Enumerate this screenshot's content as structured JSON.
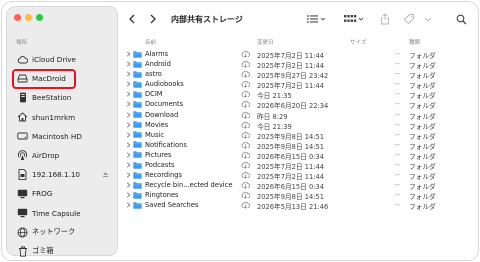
{
  "sidebar": {
    "section": "場所",
    "items": [
      {
        "label": "iCloud Drive",
        "icon": "cloud-icon",
        "selected": false,
        "eject": false
      },
      {
        "label": "MacDroid",
        "icon": "drive-icon",
        "selected": true,
        "eject": false
      },
      {
        "label": "BeeStation",
        "icon": "nas-icon",
        "selected": false,
        "eject": false
      },
      {
        "label": "shun1mrkm",
        "icon": "home-icon",
        "selected": false,
        "eject": false
      },
      {
        "label": "Macintosh HD",
        "icon": "hard-drive-icon",
        "selected": false,
        "eject": false
      },
      {
        "label": "AirDrop",
        "icon": "airdrop-icon",
        "selected": false,
        "eject": false
      },
      {
        "label": "192.168.1.10",
        "icon": "document-icon",
        "selected": false,
        "eject": true
      },
      {
        "label": "FROG",
        "icon": "monitor-icon",
        "selected": false,
        "eject": false
      },
      {
        "label": "Time Capsule",
        "icon": "monitor-icon",
        "selected": false,
        "eject": false
      },
      {
        "label": "ネットワーク",
        "icon": "network-icon",
        "selected": false,
        "eject": false
      },
      {
        "label": "ゴミ箱",
        "icon": "trash-icon",
        "selected": false,
        "eject": false
      }
    ]
  },
  "toolbar": {
    "title": "内部共有ストレージ"
  },
  "columns": {
    "name": "名前",
    "date": "変更日",
    "size": "サイズ",
    "kind": "種類"
  },
  "rows": [
    {
      "name": "Alarms",
      "date": "2025年7月2日 11:44",
      "size": "--",
      "kind": "フォルダ"
    },
    {
      "name": "Android",
      "date": "2025年7月2日 11:44",
      "size": "--",
      "kind": "フォルダ"
    },
    {
      "name": "astro",
      "date": "2025年9月27日 23:42",
      "size": "--",
      "kind": "フォルダ"
    },
    {
      "name": "Audiobooks",
      "date": "2025年7月2日 11:44",
      "size": "--",
      "kind": "フォルダ"
    },
    {
      "name": "DCIM",
      "date": "今日 21:35",
      "size": "--",
      "kind": "フォルダ"
    },
    {
      "name": "Documents",
      "date": "2026年6月20日 22:34",
      "size": "--",
      "kind": "フォルダ"
    },
    {
      "name": "Download",
      "date": "昨日 8:29",
      "size": "--",
      "kind": "フォルダ"
    },
    {
      "name": "Movies",
      "date": "今日 21:39",
      "size": "--",
      "kind": "フォルダ"
    },
    {
      "name": "Music",
      "date": "2025年9月8日 14:51",
      "size": "--",
      "kind": "フォルダ"
    },
    {
      "name": "Notifications",
      "date": "2025年9月8日 14:51",
      "size": "--",
      "kind": "フォルダ"
    },
    {
      "name": "Pictures",
      "date": "2026年6月15日 0:34",
      "size": "--",
      "kind": "フォルダ"
    },
    {
      "name": "Podcasts",
      "date": "2025年7月2日 11:44",
      "size": "--",
      "kind": "フォルダ"
    },
    {
      "name": "Recordings",
      "date": "2025年7月2日 11:44",
      "size": "--",
      "kind": "フォルダ"
    },
    {
      "name": "Recycle bin...ected device",
      "date": "2026年6月15日 0:34",
      "size": "--",
      "kind": "フォルダ"
    },
    {
      "name": "Ringtones",
      "date": "2025年9月8日 14:51",
      "size": "--",
      "kind": "フォルダ"
    },
    {
      "name": "Saved Searches",
      "date": "2026年5月13日 21:46",
      "size": "--",
      "kind": "フォルダ"
    }
  ],
  "colors": {
    "folder": "#3d9bf0",
    "selection_outline": "#e2161f",
    "sidebar_bg": "#ececec"
  }
}
